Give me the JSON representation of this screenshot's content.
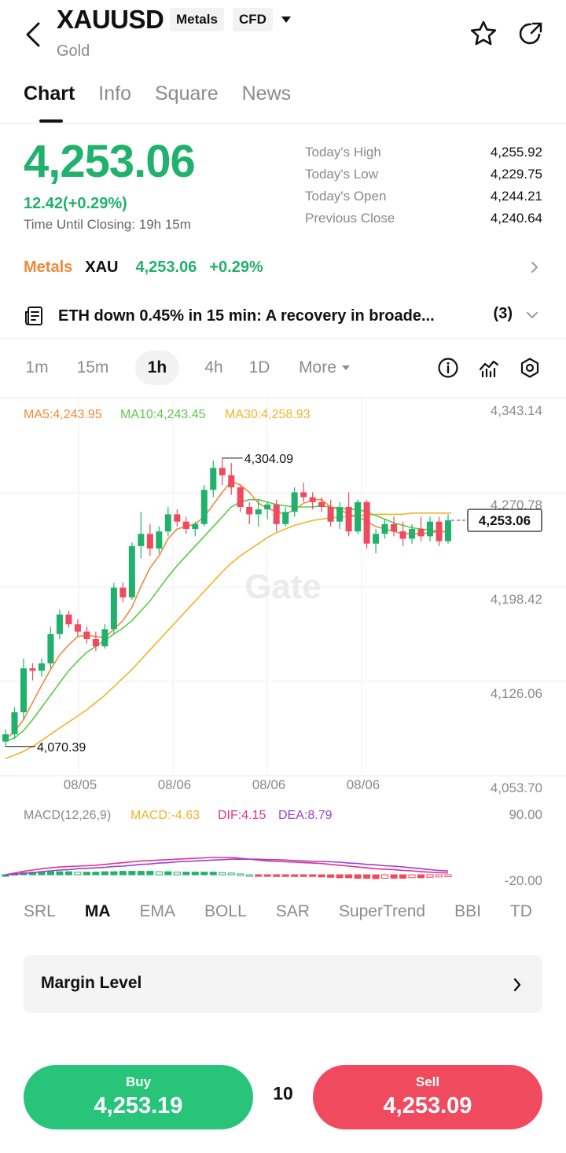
{
  "header": {
    "symbol": "XAUUSD",
    "tag_market": "Metals",
    "tag_type": "CFD",
    "name": "Gold",
    "icons": [
      "back-arrow-icon",
      "chevron-down-icon",
      "star-icon",
      "share-icon"
    ]
  },
  "tabs": [
    {
      "label": "Chart",
      "active": true
    },
    {
      "label": "Info",
      "active": false
    },
    {
      "label": "Square",
      "active": false
    },
    {
      "label": "News",
      "active": false
    }
  ],
  "price": {
    "last": "4,253.06",
    "change": "12.42(+0.29%)",
    "closing_label": "Time Until Closing:",
    "closing_value": "19h 15m",
    "color_up": "#20b26c"
  },
  "stats": [
    {
      "label": "Today's High",
      "value": "4,255.92"
    },
    {
      "label": "Today's Low",
      "value": "4,229.75"
    },
    {
      "label": "Today's Open",
      "value": "4,244.21"
    },
    {
      "label": "Previous Close",
      "value": "4,240.64"
    }
  ],
  "metals_strip": {
    "category": "Metals",
    "code": "XAU",
    "price": "4,253.06",
    "change": "+0.29%"
  },
  "news": {
    "text": "ETH down 0.45% in 15 min: A recovery in broade...",
    "count": "(3)"
  },
  "intervals": [
    {
      "label": "1m",
      "active": false
    },
    {
      "label": "15m",
      "active": false
    },
    {
      "label": "1h",
      "active": true
    },
    {
      "label": "4h",
      "active": false
    },
    {
      "label": "1D",
      "active": false
    },
    {
      "label": "More",
      "active": false
    }
  ],
  "chart_tools": [
    "info-icon",
    "indicator-icon",
    "settings-icon"
  ],
  "chart": {
    "ma_legend": [
      {
        "label": "MA5:4,243.95",
        "color": "#f08a3a"
      },
      {
        "label": "MA10:4,243.45",
        "color": "#5cc94a"
      },
      {
        "label": "MA30:4,258.93",
        "color": "#f0b429"
      }
    ],
    "price_axis": [
      "4,343.14",
      "4,270.78",
      "4,198.42",
      "4,126.06",
      "4,053.70"
    ],
    "high_marker": "4,304.09",
    "low_marker": "4,070.39",
    "last_tag": "4,253.06",
    "date_labels": [
      "08/05",
      "08/06",
      "08/06",
      "08/06"
    ],
    "watermark": "Gate",
    "macd_legend": [
      {
        "label": "MACD(12,26,9)",
        "color": "#8a8a8a"
      },
      {
        "label": "MACD:-4.63",
        "color": "#f0b429"
      },
      {
        "label": "DIF:4.15",
        "color": "#e0348a"
      },
      {
        "label": "DEA:8.79",
        "color": "#9b3fd1"
      }
    ],
    "macd_axis": [
      "90.00",
      "-20.00"
    ],
    "up_color": "#20b26c",
    "down_color": "#f04a5f"
  },
  "chart_data": {
    "type": "candlestick",
    "ylim": [
      4053.7,
      4343.14
    ],
    "candles": [
      {
        "o": 4072,
        "h": 4082,
        "l": 4068,
        "c": 4078
      },
      {
        "o": 4078,
        "h": 4100,
        "l": 4074,
        "c": 4096
      },
      {
        "o": 4096,
        "h": 4140,
        "l": 4090,
        "c": 4132
      },
      {
        "o": 4132,
        "h": 4136,
        "l": 4122,
        "c": 4130
      },
      {
        "o": 4130,
        "h": 4140,
        "l": 4125,
        "c": 4136
      },
      {
        "o": 4136,
        "h": 4166,
        "l": 4132,
        "c": 4160
      },
      {
        "o": 4160,
        "h": 4180,
        "l": 4156,
        "c": 4176
      },
      {
        "o": 4176,
        "h": 4179,
        "l": 4165,
        "c": 4168
      },
      {
        "o": 4168,
        "h": 4172,
        "l": 4158,
        "c": 4162
      },
      {
        "o": 4162,
        "h": 4166,
        "l": 4152,
        "c": 4156
      },
      {
        "o": 4156,
        "h": 4162,
        "l": 4146,
        "c": 4150
      },
      {
        "o": 4150,
        "h": 4168,
        "l": 4148,
        "c": 4164
      },
      {
        "o": 4164,
        "h": 4202,
        "l": 4160,
        "c": 4198
      },
      {
        "o": 4198,
        "h": 4202,
        "l": 4186,
        "c": 4190
      },
      {
        "o": 4190,
        "h": 4235,
        "l": 4188,
        "c": 4232
      },
      {
        "o": 4232,
        "h": 4260,
        "l": 4222,
        "c": 4242
      },
      {
        "o": 4242,
        "h": 4250,
        "l": 4224,
        "c": 4230
      },
      {
        "o": 4230,
        "h": 4248,
        "l": 4226,
        "c": 4244
      },
      {
        "o": 4244,
        "h": 4264,
        "l": 4240,
        "c": 4258
      },
      {
        "o": 4258,
        "h": 4262,
        "l": 4248,
        "c": 4252
      },
      {
        "o": 4252,
        "h": 4256,
        "l": 4242,
        "c": 4246
      },
      {
        "o": 4246,
        "h": 4252,
        "l": 4240,
        "c": 4250
      },
      {
        "o": 4250,
        "h": 4282,
        "l": 4248,
        "c": 4278
      },
      {
        "o": 4278,
        "h": 4302,
        "l": 4272,
        "c": 4296
      },
      {
        "o": 4296,
        "h": 4304,
        "l": 4282,
        "c": 4290
      },
      {
        "o": 4290,
        "h": 4300,
        "l": 4274,
        "c": 4280
      },
      {
        "o": 4280,
        "h": 4282,
        "l": 4260,
        "c": 4264
      },
      {
        "o": 4264,
        "h": 4268,
        "l": 4250,
        "c": 4258
      },
      {
        "o": 4258,
        "h": 4270,
        "l": 4248,
        "c": 4262
      },
      {
        "o": 4262,
        "h": 4268,
        "l": 4254,
        "c": 4266
      },
      {
        "o": 4266,
        "h": 4270,
        "l": 4244,
        "c": 4250
      },
      {
        "o": 4250,
        "h": 4264,
        "l": 4248,
        "c": 4260
      },
      {
        "o": 4260,
        "h": 4280,
        "l": 4256,
        "c": 4276
      },
      {
        "o": 4276,
        "h": 4284,
        "l": 4268,
        "c": 4272
      },
      {
        "o": 4272,
        "h": 4276,
        "l": 4262,
        "c": 4268
      },
      {
        "o": 4268,
        "h": 4272,
        "l": 4260,
        "c": 4264
      },
      {
        "o": 4264,
        "h": 4270,
        "l": 4248,
        "c": 4252
      },
      {
        "o": 4252,
        "h": 4268,
        "l": 4246,
        "c": 4264
      },
      {
        "o": 4264,
        "h": 4276,
        "l": 4240,
        "c": 4244
      },
      {
        "o": 4244,
        "h": 4270,
        "l": 4242,
        "c": 4268
      },
      {
        "o": 4268,
        "h": 4270,
        "l": 4230,
        "c": 4234
      },
      {
        "o": 4234,
        "h": 4246,
        "l": 4226,
        "c": 4242
      },
      {
        "o": 4242,
        "h": 4254,
        "l": 4238,
        "c": 4250
      },
      {
        "o": 4250,
        "h": 4256,
        "l": 4240,
        "c": 4244
      },
      {
        "o": 4244,
        "h": 4252,
        "l": 4232,
        "c": 4238
      },
      {
        "o": 4238,
        "h": 4250,
        "l": 4234,
        "c": 4246
      },
      {
        "o": 4246,
        "h": 4256,
        "l": 4236,
        "c": 4240
      },
      {
        "o": 4240,
        "h": 4256,
        "l": 4236,
        "c": 4252
      },
      {
        "o": 4252,
        "h": 4256,
        "l": 4232,
        "c": 4236
      },
      {
        "o": 4236,
        "h": 4258,
        "l": 4234,
        "c": 4253.06
      }
    ],
    "ma5": [
      4074,
      4080,
      4090,
      4104,
      4118,
      4131,
      4143,
      4151,
      4158,
      4159,
      4158,
      4157,
      4164,
      4171,
      4182,
      4199,
      4214,
      4224,
      4238,
      4246,
      4248,
      4250,
      4256,
      4266,
      4276,
      4285,
      4282,
      4276,
      4267,
      4263,
      4260,
      4258,
      4262,
      4267,
      4270,
      4270,
      4264,
      4262,
      4258,
      4256,
      4252,
      4248,
      4246,
      4244,
      4242,
      4242,
      4242,
      4243,
      4244,
      4243.95
    ],
    "ma10": [
      4072,
      4075,
      4081,
      4090,
      4100,
      4110,
      4120,
      4130,
      4138,
      4145,
      4150,
      4155,
      4160,
      4165,
      4171,
      4179,
      4187,
      4197,
      4207,
      4216,
      4224,
      4232,
      4240,
      4248,
      4256,
      4264,
      4268,
      4270,
      4270,
      4268,
      4266,
      4265,
      4264,
      4264,
      4264,
      4265,
      4264,
      4263,
      4262,
      4262,
      4260,
      4257,
      4254,
      4251,
      4249,
      4247,
      4246,
      4245,
      4244,
      4243.45
    ],
    "ma30": [
      4058,
      4061,
      4064,
      4068,
      4073,
      4078,
      4083,
      4088,
      4093,
      4098,
      4104,
      4110,
      4117,
      4124,
      4131,
      4139,
      4147,
      4155,
      4163,
      4171,
      4179,
      4187,
      4195,
      4203,
      4211,
      4218,
      4224,
      4229,
      4234,
      4239,
      4243,
      4246,
      4249,
      4251,
      4253,
      4254,
      4255,
      4256,
      4256,
      4257,
      4257,
      4258,
      4258,
      4258,
      4258,
      4259,
      4259,
      4259,
      4259,
      4258.93
    ],
    "macd_ylim": [
      -20,
      90
    ],
    "dif": [
      0,
      4,
      8,
      11,
      14,
      16,
      18,
      19,
      20,
      21,
      22,
      24,
      26,
      28,
      30,
      32,
      33,
      34,
      35,
      36,
      37,
      38,
      39,
      40,
      40,
      40,
      38,
      36,
      34,
      32,
      31,
      30,
      29,
      28,
      27,
      26,
      24,
      22,
      20,
      18,
      16,
      14,
      13,
      12,
      10,
      9,
      7,
      6,
      5,
      4.15
    ],
    "dea": [
      0,
      1,
      3,
      5,
      7,
      9,
      11,
      12,
      14,
      15,
      16,
      17,
      19,
      20,
      22,
      24,
      25,
      27,
      28,
      30,
      31,
      32,
      33,
      34,
      35,
      36,
      36,
      36,
      36,
      35,
      35,
      34,
      33,
      32,
      31,
      31,
      30,
      29,
      27,
      26,
      24,
      23,
      21,
      20,
      18,
      16,
      14,
      12,
      10,
      8.79
    ]
  },
  "indicator_tabs": [
    {
      "label": "SRL",
      "active": false
    },
    {
      "label": "MA",
      "active": true
    },
    {
      "label": "EMA",
      "active": false
    },
    {
      "label": "BOLL",
      "active": false
    },
    {
      "label": "SAR",
      "active": false
    },
    {
      "label": "SuperTrend",
      "active": false
    },
    {
      "label": "BBI",
      "active": false
    },
    {
      "label": "TD",
      "active": false
    }
  ],
  "margin": {
    "label": "Margin Level"
  },
  "trade": {
    "buy_label": "Buy",
    "buy_price": "4,253.19",
    "spread": "10",
    "sell_label": "Sell",
    "sell_price": "4,253.09",
    "buy_color": "#27c47a",
    "sell_color": "#f04a5f"
  }
}
